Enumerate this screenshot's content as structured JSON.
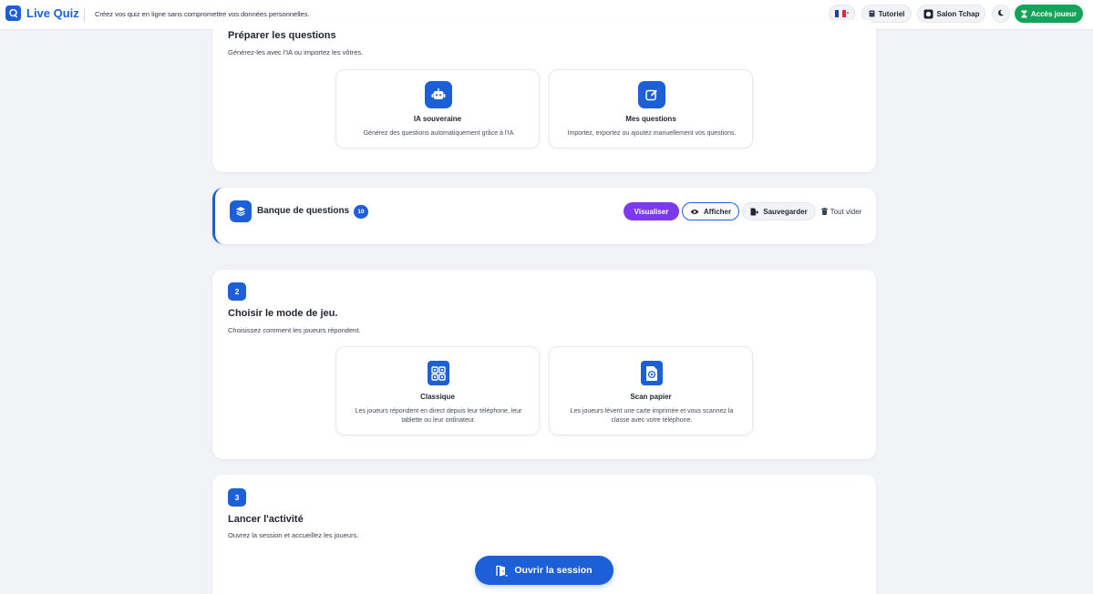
{
  "header": {
    "app_name": "Live Quiz",
    "tagline": "Créez vos quiz en ligne sans compromettre vos données personnelles.",
    "language_flag_icon": "french-flag-icon",
    "tutorial_label": "Tutoriel",
    "salon_label": "Salon Tchap",
    "player_access_label": "Accès joueur"
  },
  "colors": {
    "primary": "#1d5fd6",
    "success": "#15a35a",
    "violet": "#7c3aed",
    "background": "#f1f3f6"
  },
  "section1": {
    "title": "Préparer les questions",
    "subtitle": "Générez-les avec l'IA ou importez les vôtres.",
    "options": [
      {
        "icon": "robot-icon",
        "title": "IA souveraine",
        "description": "Générez des questions automatiquement grâce à l'IA"
      },
      {
        "icon": "edit-icon",
        "title": "Mes questions",
        "description": "Importez, exportez ou ajoutez manuellement vos questions."
      }
    ]
  },
  "bank": {
    "title": "Banque de questions",
    "count": "10",
    "visualize_label": "Visualiser",
    "show_label": "Afficher",
    "save_label": "Sauvegarder",
    "clear_label": "Tout vider"
  },
  "section2": {
    "step": "2",
    "title": "Choisir le mode de jeu.",
    "subtitle": "Choisissez comment les joueurs répondent.",
    "options": [
      {
        "icon": "qr-grid-icon",
        "title": "Classique",
        "description": "Les joueurs répondent en direct depuis leur téléphone, leur tablette ou leur ordinateur."
      },
      {
        "icon": "scan-card-icon",
        "title": "Scan papier",
        "description": "Les joueurs lèvent une carte imprimée et vous scannez la classe avec votre téléphone."
      }
    ]
  },
  "section3": {
    "step": "3",
    "title": "Lancer l'activité",
    "subtitle": "Ouvrez la session et accueillez les joueurs.",
    "launch_label": "Ouvrir la session"
  }
}
